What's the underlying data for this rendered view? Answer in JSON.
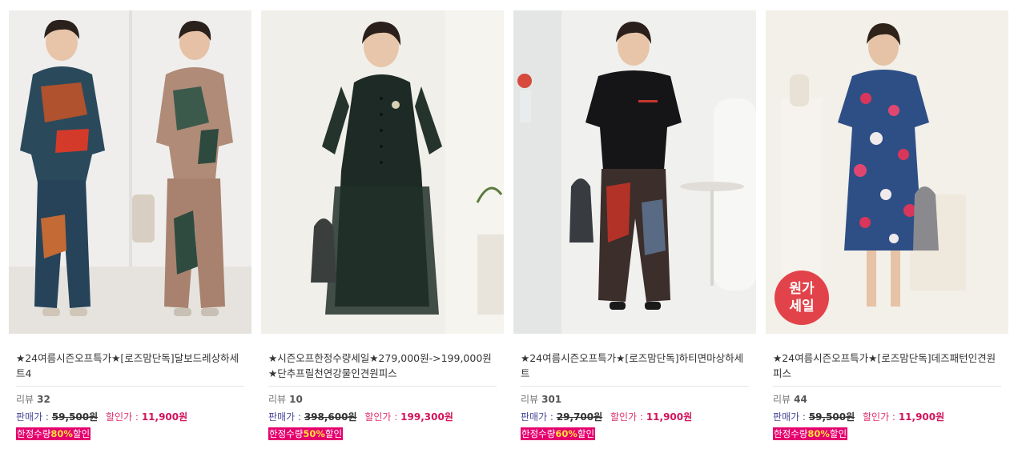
{
  "products": [
    {
      "title": "★24여름시즌오프특가★[로즈맘단독]달보드레상하세트4",
      "review_label": "리뷰",
      "review_count": "32",
      "price_label": "판매가 :",
      "original_price": "59,500원",
      "discount_label": "할인가 :",
      "discount_price": "11,900원",
      "promo_prefix": "한정수량",
      "promo_percent": "80%",
      "promo_suffix": "할인",
      "image": "two-women-print-set"
    },
    {
      "title": "★시즌오프한정수량세일★279,000원->199,000원★단추프릴천연강물인견원피스",
      "review_label": "리뷰",
      "review_count": "10",
      "price_label": "판매가 :",
      "original_price": "398,600원",
      "discount_label": "할인가 :",
      "discount_price": "199,300원",
      "promo_prefix": "한정수량",
      "promo_percent": "50%",
      "promo_suffix": "할인",
      "image": "woman-dark-green-dress"
    },
    {
      "title": "★24여름시즌오프특가★[로즈맘단독]하티면마상하세트",
      "review_label": "리뷰",
      "review_count": "301",
      "price_label": "판매가 :",
      "original_price": "29,700원",
      "discount_label": "할인가 :",
      "discount_price": "11,900원",
      "promo_prefix": "한정수량",
      "promo_percent": "60%",
      "promo_suffix": "할인",
      "image": "woman-black-top-print-pants"
    },
    {
      "title": "★24여름시즌오프특가★[로즈맘단독]데즈패턴인견원피스",
      "review_label": "리뷰",
      "review_count": "44",
      "price_label": "판매가 :",
      "original_price": "59,500원",
      "discount_label": "할인가 :",
      "discount_price": "11,900원",
      "promo_prefix": "한정수량",
      "promo_percent": "80%",
      "promo_suffix": "할인",
      "badge_line1": "원가",
      "badge_line2": "세일",
      "image": "woman-floral-dress"
    }
  ]
}
